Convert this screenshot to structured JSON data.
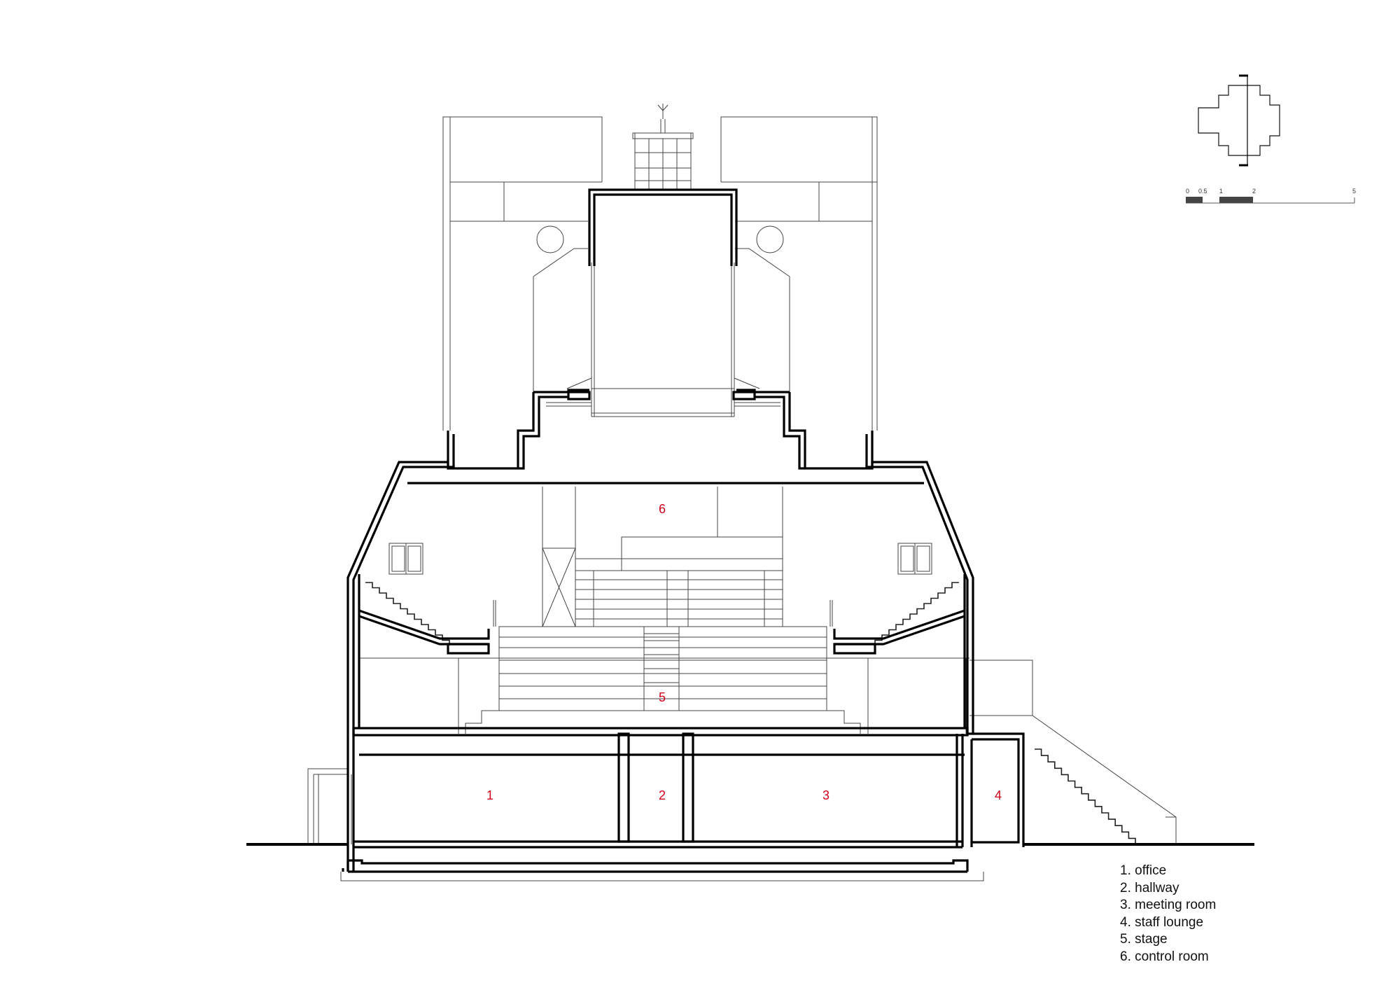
{
  "rooms": [
    {
      "num": "1",
      "name": "office"
    },
    {
      "num": "2",
      "name": "hallway"
    },
    {
      "num": "3",
      "name": "meeting room"
    },
    {
      "num": "4",
      "name": "staff lounge"
    },
    {
      "num": "5",
      "name": "stage"
    },
    {
      "num": "6",
      "name": "control room"
    }
  ],
  "legend": [
    "1. office",
    "2. hallway",
    "3. meeting room",
    "4. staff lounge",
    "5. stage",
    "6. control room"
  ],
  "scale_bar": {
    "ticks": [
      "0",
      "0.5",
      "1",
      "2",
      "5"
    ]
  },
  "colors": {
    "room_label": "#d0021b",
    "cut_line": "#000000",
    "projection_line": "#444444"
  }
}
